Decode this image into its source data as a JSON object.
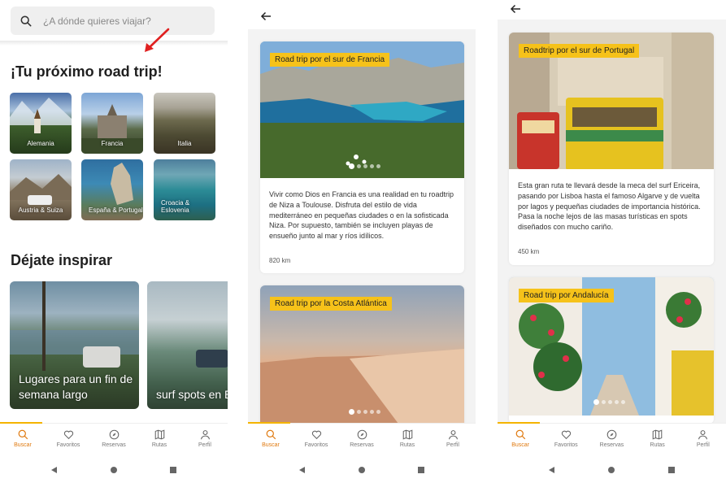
{
  "screen1": {
    "search_placeholder": "¿A dónde quieres viajar?",
    "section_title": "¡Tu próximo road trip!",
    "destinations": [
      {
        "label": "Alemania"
      },
      {
        "label": "Francia"
      },
      {
        "label": "Italia"
      },
      {
        "label": "Austria & Suiza"
      },
      {
        "label": "España & Portugal"
      },
      {
        "label": "Croacia & Eslovenia"
      }
    ],
    "inspire_title": "Déjate inspirar",
    "inspire_cards": [
      {
        "title": "Lugares para un fin de semana largo"
      },
      {
        "title": "surf spots en España, Portugal e Italia"
      }
    ]
  },
  "screen2": {
    "cards": [
      {
        "tag": "Road trip por el sur de Francia",
        "description": "Vivir como Dios en Francia es una realidad en tu roadtrip de Niza a Toulouse. Disfruta del estilo de vida mediterráneo en pequeñas ciudades o en la sofisticada Niza. Por supuesto, también se incluyen playas de ensueño junto al mar y ríos idílicos.",
        "distance": "820 km"
      },
      {
        "tag": "Road trip por la Costa Atlántica"
      }
    ]
  },
  "screen3": {
    "cards": [
      {
        "tag": "Roadtrip por el sur de Portugal",
        "description": "Esta gran ruta te llevará desde la meca del surf Ericeira, pasando por Lisboa hasta el famoso Algarve y de vuelta por lagos y pequeñas ciudades de importancia histórica. Pasa la noche lejos de las masas turísticas en spots diseñados con mucho cariño.",
        "distance": "450 km"
      },
      {
        "tag": "Road trip por Andalucía"
      }
    ]
  },
  "nav": [
    {
      "label": "Buscar",
      "icon": "search-icon"
    },
    {
      "label": "Favoritos",
      "icon": "heart-icon"
    },
    {
      "label": "Reservas",
      "icon": "compass-icon"
    },
    {
      "label": "Rutas",
      "icon": "map-icon"
    },
    {
      "label": "Perfil",
      "icon": "user-icon"
    }
  ],
  "colors": {
    "accent": "#f6c21a",
    "nav_active": "#e07a10",
    "annotation_arrow": "#e02020"
  }
}
